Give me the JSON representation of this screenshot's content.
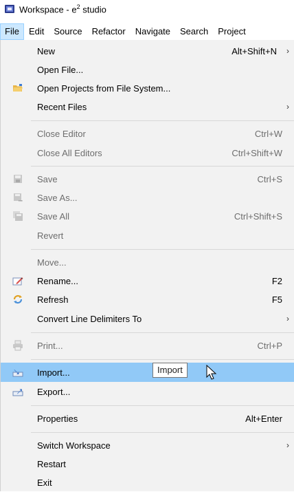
{
  "window": {
    "title_prefix": "Workspace - e",
    "title_sup": "2",
    "title_suffix": " studio"
  },
  "menubar": [
    "File",
    "Edit",
    "Source",
    "Refactor",
    "Navigate",
    "Search",
    "Project"
  ],
  "menu": {
    "new": {
      "label": "New",
      "shortcut": "Alt+Shift+N"
    },
    "open_file": {
      "label": "Open File..."
    },
    "open_projects": {
      "label": "Open Projects from File System..."
    },
    "recent_files": {
      "label": "Recent Files"
    },
    "close_editor": {
      "label": "Close Editor",
      "shortcut": "Ctrl+W"
    },
    "close_all": {
      "label": "Close All Editors",
      "shortcut": "Ctrl+Shift+W"
    },
    "save": {
      "label": "Save",
      "shortcut": "Ctrl+S"
    },
    "save_as": {
      "label": "Save As..."
    },
    "save_all": {
      "label": "Save All",
      "shortcut": "Ctrl+Shift+S"
    },
    "revert": {
      "label": "Revert"
    },
    "move": {
      "label": "Move..."
    },
    "rename": {
      "label": "Rename...",
      "shortcut": "F2"
    },
    "refresh": {
      "label": "Refresh",
      "shortcut": "F5"
    },
    "convert": {
      "label": "Convert Line Delimiters To"
    },
    "print": {
      "label": "Print...",
      "shortcut": "Ctrl+P"
    },
    "import": {
      "label": "Import..."
    },
    "export": {
      "label": "Export..."
    },
    "properties": {
      "label": "Properties",
      "shortcut": "Alt+Enter"
    },
    "switch_ws": {
      "label": "Switch Workspace"
    },
    "restart": {
      "label": "Restart"
    },
    "exit": {
      "label": "Exit"
    }
  },
  "tooltip": {
    "text": "Import"
  },
  "submenu_arrow": "›"
}
